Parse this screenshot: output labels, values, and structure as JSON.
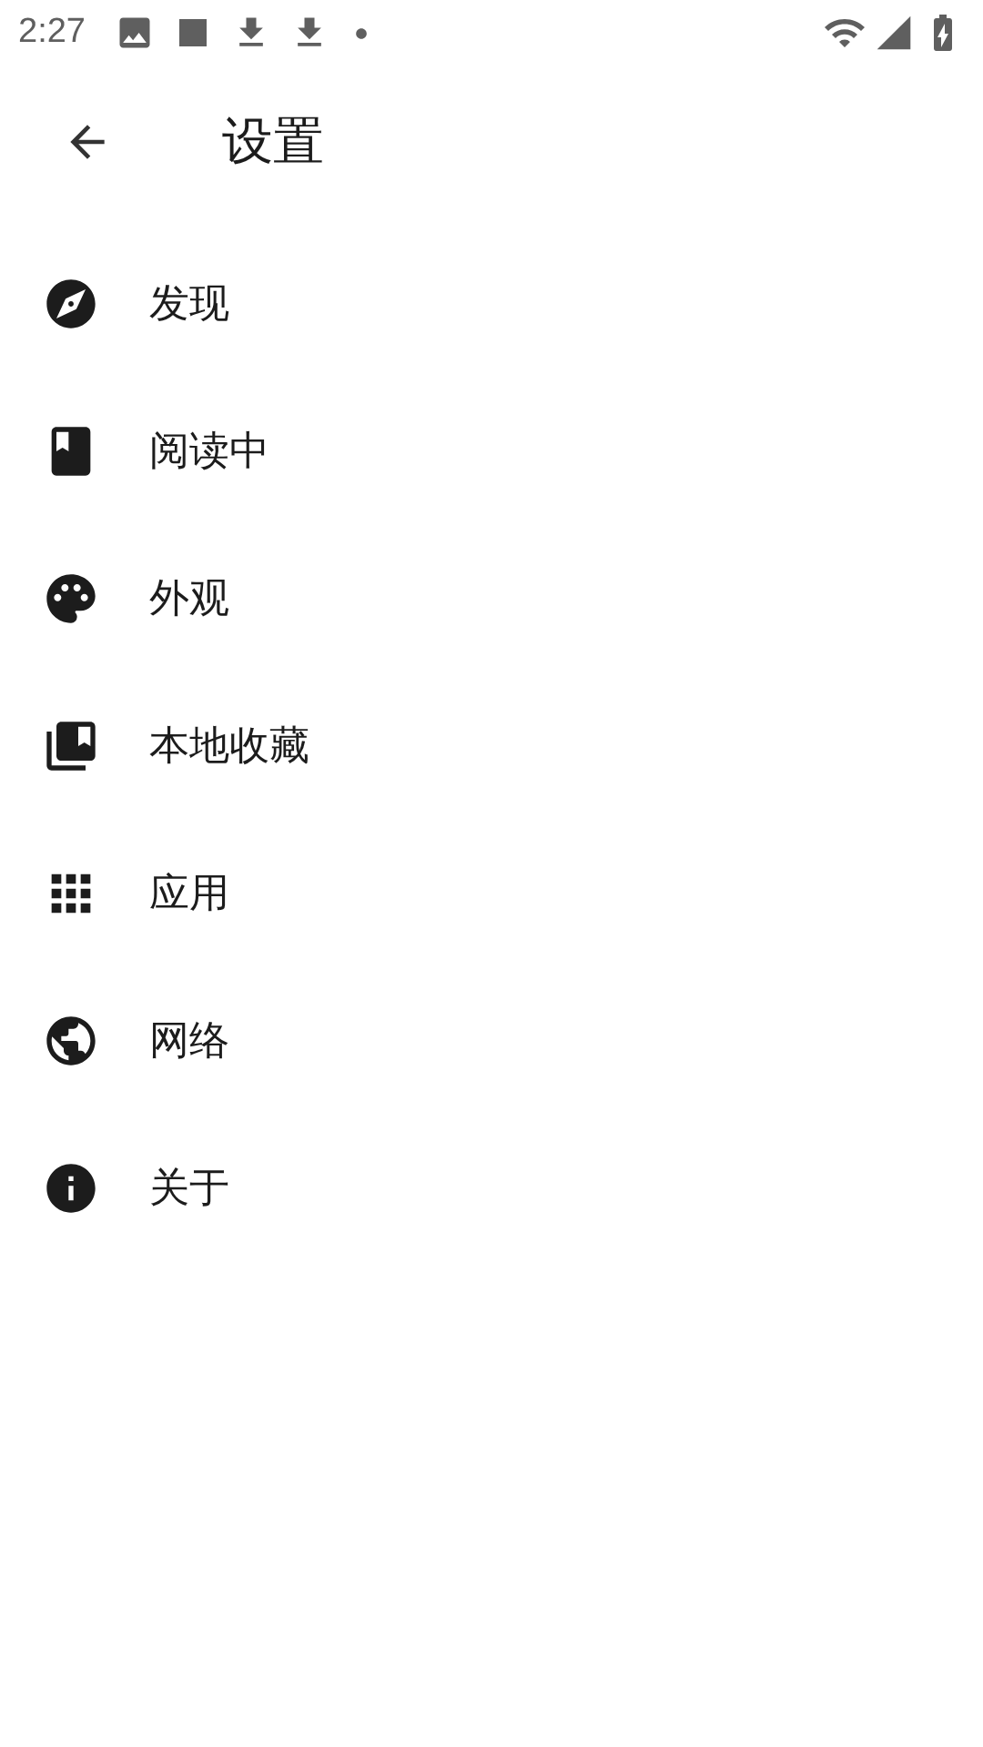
{
  "status_bar": {
    "time": "2:27"
  },
  "app_bar": {
    "title": "设置"
  },
  "items": [
    {
      "label": "发现"
    },
    {
      "label": "阅读中"
    },
    {
      "label": "外观"
    },
    {
      "label": "本地收藏"
    },
    {
      "label": "应用"
    },
    {
      "label": "网络"
    },
    {
      "label": "关于"
    }
  ]
}
